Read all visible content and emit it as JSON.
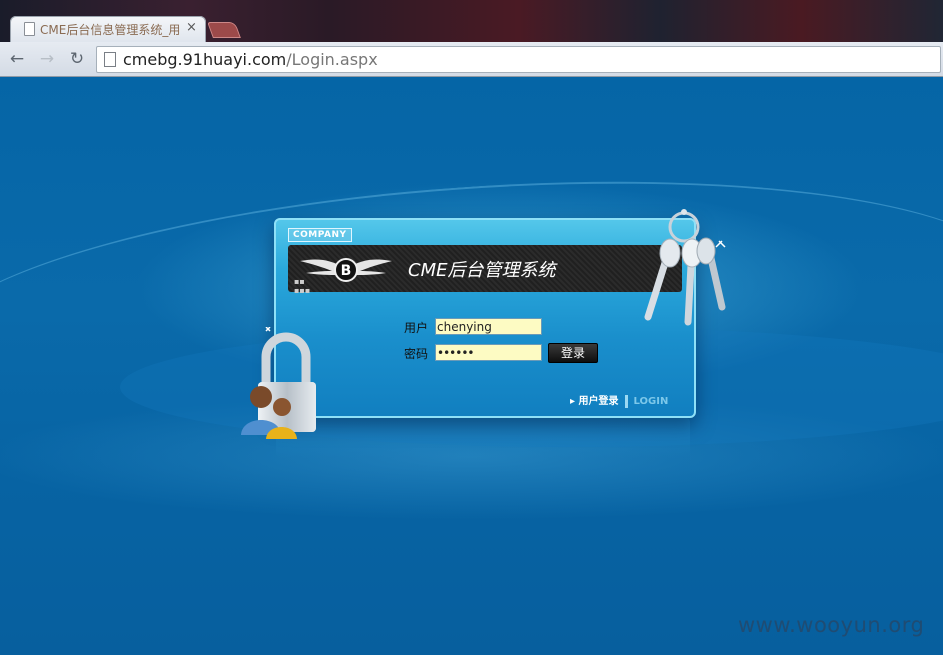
{
  "browser": {
    "tab_title": "CME后台信息管理系统_用",
    "tab_close": "×",
    "url_host": "cmebg.91huayi.com",
    "url_path": "/Login.aspx",
    "back_glyph": "←",
    "forward_glyph": "→",
    "reload_glyph": "↻"
  },
  "panel": {
    "company_label": "COMPANY",
    "system_title": "CME后台管理系统",
    "user_label": "用户",
    "user_value": "chenying",
    "password_label": "密码",
    "password_value": "••••••",
    "login_button": "登录",
    "footer_user_login": "▸ 用户登录",
    "footer_login_en": "LOGIN",
    "logo_letter": "B"
  },
  "watermark": "www.wooyun.org",
  "colors": {
    "page_bg": "#0a67a8",
    "panel_top": "#54c7ea",
    "input_bg": "#fdfbc3"
  }
}
